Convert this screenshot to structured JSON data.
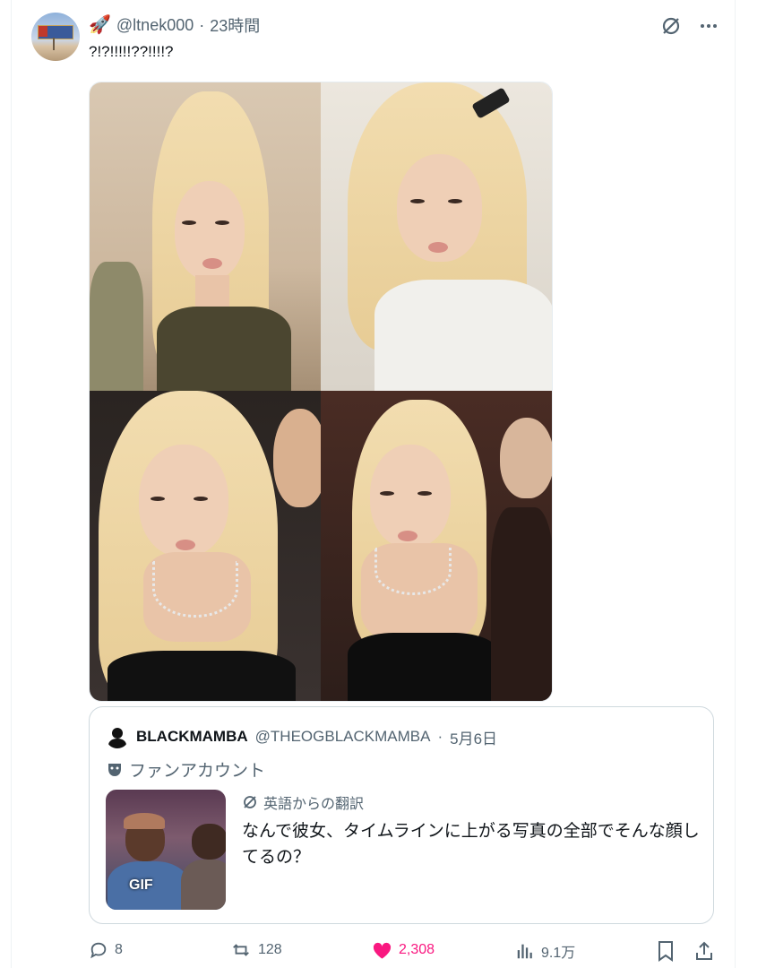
{
  "tweet": {
    "emoji": "🚀",
    "handle": "@ltnek000",
    "separator": "·",
    "time": "23時間",
    "text": "?!?!!!!!??!!!!?"
  },
  "icons": {
    "grok": "slashed-circle-icon",
    "more": "more-icon"
  },
  "media": {
    "photos": [
      "photo-1",
      "photo-2",
      "photo-3",
      "photo-4"
    ]
  },
  "quote": {
    "name": "BLACKMAMBA",
    "handle": "@THEOGBLACKMAMBA",
    "separator": "·",
    "date": "5月6日",
    "label": "ファンアカウント",
    "gif_badge": "GIF",
    "translation_label": "英語からの翻訳",
    "text": "なんで彼女、タイムラインに上がる写真の全部でそんな顔してるの？"
  },
  "actions": {
    "replies": "8",
    "retweets": "128",
    "likes": "2,308",
    "views": "9.1万"
  },
  "colors": {
    "text": "#0f1419",
    "muted": "#536471",
    "like": "#f91880",
    "border": "#cfd9de"
  }
}
